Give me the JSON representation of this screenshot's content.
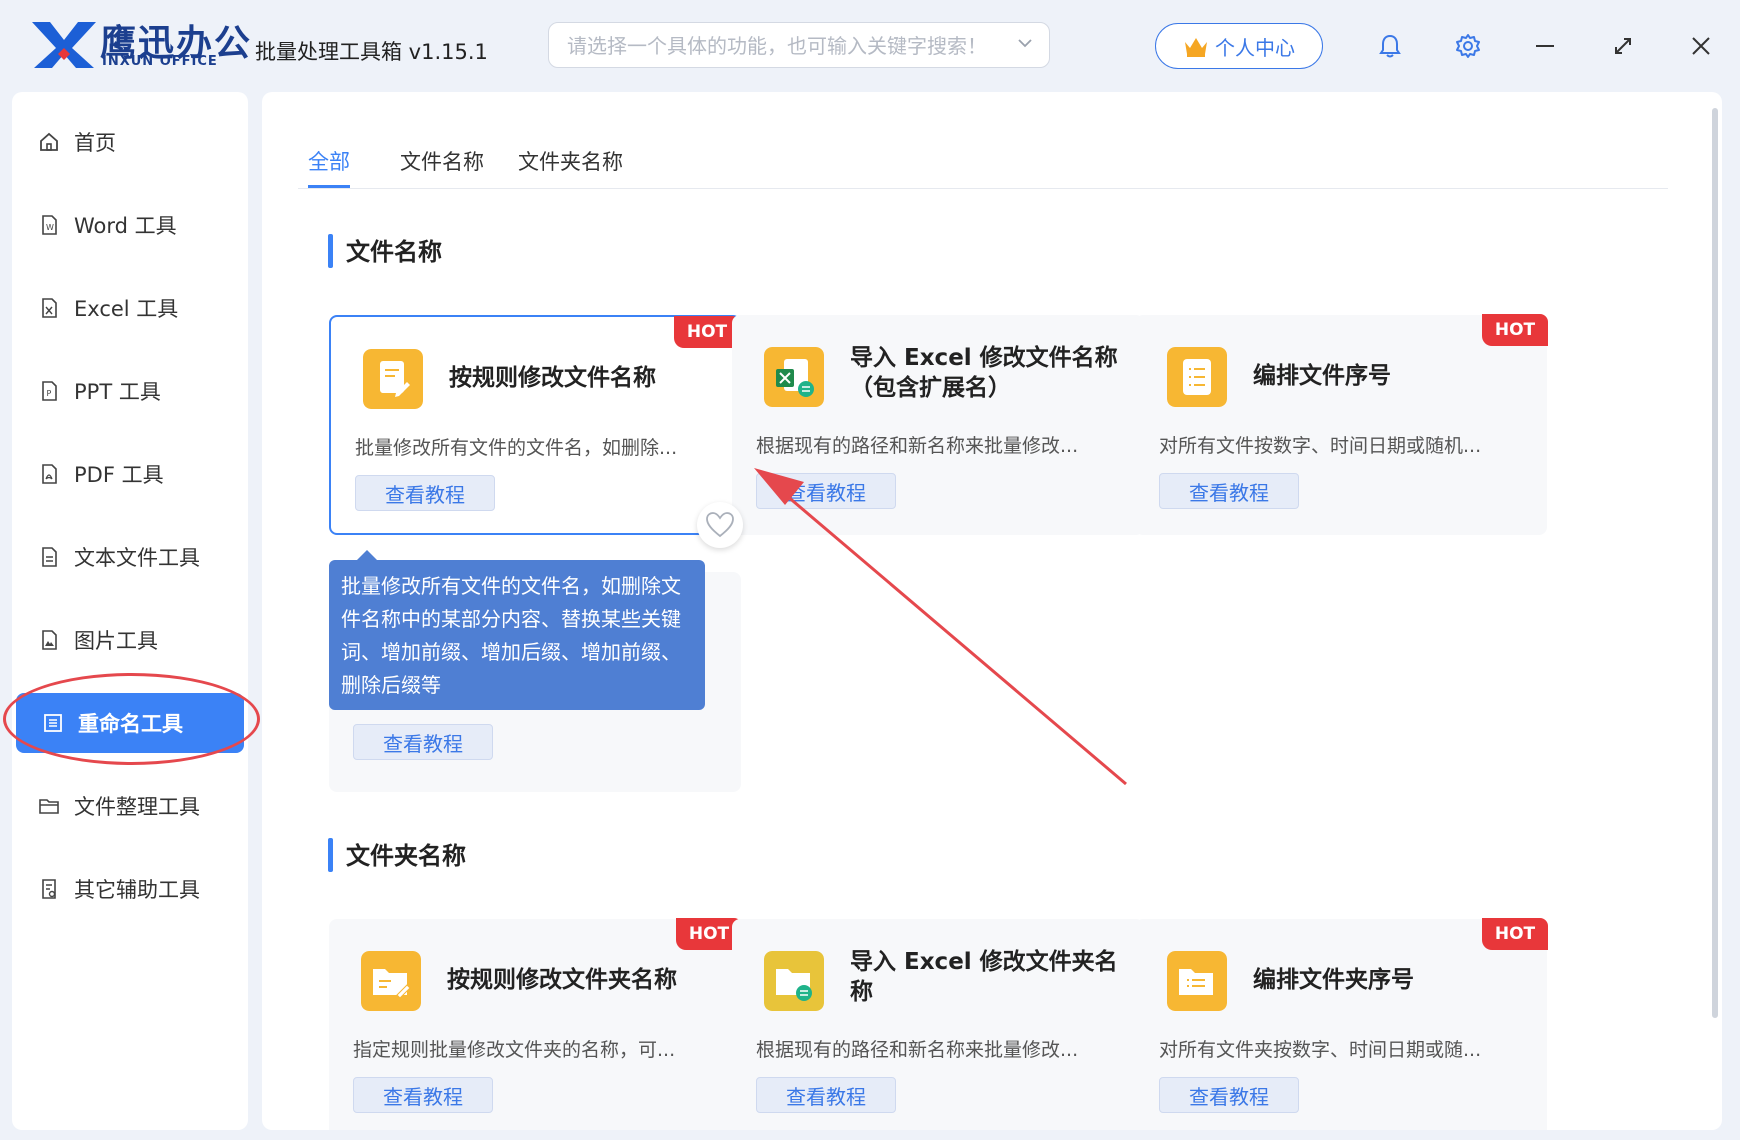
{
  "brand": {
    "name_cn": "鹰迅办公",
    "name_en": "INXUN OFFICE"
  },
  "app_title": "批量处理工具箱 v1.15.1",
  "search": {
    "placeholder": "请选择一个具体的功能，也可输入关键字搜索！"
  },
  "user_center_label": "个人中心",
  "sidebar": {
    "items": [
      {
        "label": "首页",
        "icon": "home-icon"
      },
      {
        "label": "Word 工具",
        "icon": "word-file-icon"
      },
      {
        "label": "Excel 工具",
        "icon": "excel-file-icon"
      },
      {
        "label": "PPT 工具",
        "icon": "ppt-file-icon"
      },
      {
        "label": "PDF 工具",
        "icon": "pdf-file-icon"
      },
      {
        "label": "文本文件工具",
        "icon": "text-file-icon"
      },
      {
        "label": "图片工具",
        "icon": "image-file-icon"
      },
      {
        "label": "重命名工具",
        "icon": "rename-icon",
        "active": true
      },
      {
        "label": "文件整理工具",
        "icon": "folder-icon"
      },
      {
        "label": "其它辅助工具",
        "icon": "misc-tools-icon"
      }
    ]
  },
  "tabs": [
    {
      "label": "全部",
      "active": true
    },
    {
      "label": "文件名称"
    },
    {
      "label": "文件夹名称"
    }
  ],
  "sections": {
    "file_name": {
      "title": "文件名称",
      "cards": [
        {
          "title": "按规则修改文件名称",
          "desc": "批量修改所有文件的文件名，如删除...",
          "button": "查看教程",
          "hot": "HOT"
        },
        {
          "title": "导入 Excel 修改文件名称（包含扩展名）",
          "desc": "根据现有的路径和新名称来批量修改...",
          "button": "查看教程"
        },
        {
          "title": "编排文件序号",
          "desc": "对所有文件按数字、时间日期或随机...",
          "button": "查看教程",
          "hot": "HOT"
        },
        {
          "button": "查看教程"
        }
      ]
    },
    "folder_name": {
      "title": "文件夹名称",
      "cards": [
        {
          "title": "按规则修改文件夹名称",
          "desc": "指定规则批量修改文件夹的名称，可...",
          "button": "查看教程",
          "hot": "HOT"
        },
        {
          "title": "导入 Excel 修改文件夹名称",
          "desc": "根据现有的路径和新名称来批量修改...",
          "button": "查看教程"
        },
        {
          "title": "编排文件夹序号",
          "desc": "对所有文件夹按数字、时间日期或随...",
          "button": "查看教程",
          "hot": "HOT"
        }
      ]
    }
  },
  "tooltip": "批量修改所有文件的文件名，如删除文件名称中的某部分内容、替换某些关键词、增加前缀、增加后缀、增加前缀、删除后缀等",
  "colors": {
    "accent": "#3b82f6",
    "hot": "#e8373a",
    "annotation": "#e5484d",
    "icon_orange": "#f7b733"
  }
}
